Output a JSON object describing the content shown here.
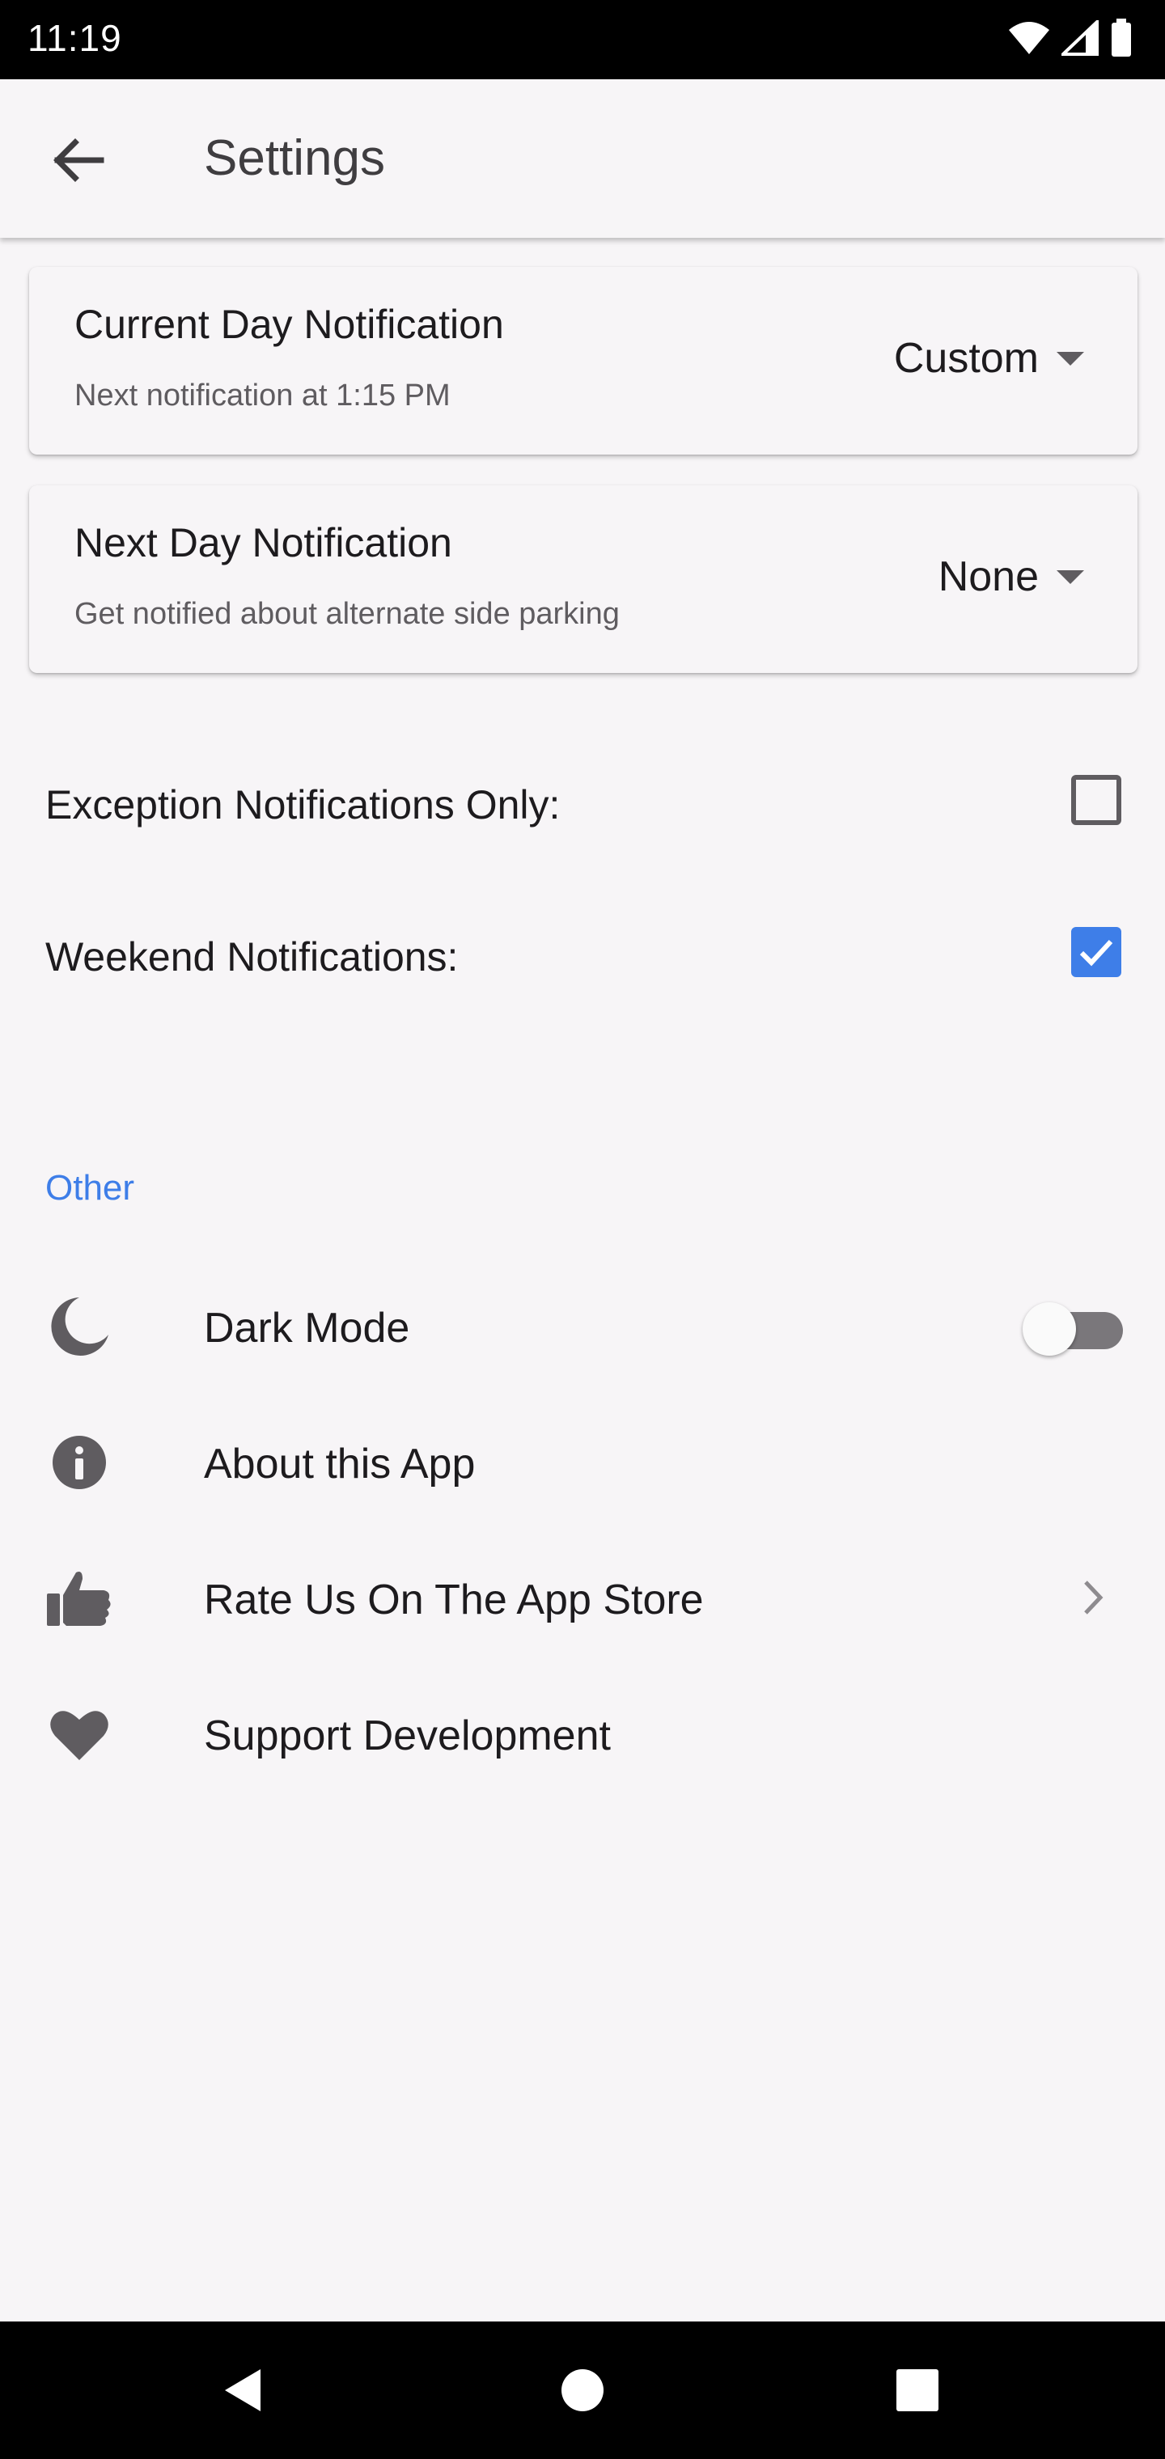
{
  "status_bar": {
    "time": "11:19",
    "icons": [
      "wifi-icon",
      "cellular-signal-icon",
      "battery-icon"
    ]
  },
  "app_bar": {
    "back_icon": "arrow-left-icon",
    "title": "Settings"
  },
  "notification_cards": [
    {
      "title": "Current Day Notification",
      "subtitle": "Next notification at 1:15 PM",
      "selected_value": "Custom"
    },
    {
      "title": "Next Day Notification",
      "subtitle": "Get notified about alternate side parking",
      "selected_value": "None"
    }
  ],
  "checkboxes": [
    {
      "label": "Exception Notifications Only:",
      "checked": false
    },
    {
      "label": "Weekend Notifications:",
      "checked": true
    }
  ],
  "other_section": {
    "header": "Other",
    "items": [
      {
        "label": "Dark Mode",
        "icon": "moon-icon",
        "control": "toggle",
        "toggle_on": false
      },
      {
        "label": "About this App",
        "icon": "info-icon",
        "control": "none"
      },
      {
        "label": "Rate Us On The App Store",
        "icon": "thumbs-up-icon",
        "control": "chevron"
      },
      {
        "label": "Support Development",
        "icon": "heart-icon",
        "control": "none"
      }
    ]
  },
  "nav_bar": {
    "buttons": [
      "back-triangle-icon",
      "home-circle-icon",
      "recents-square-icon"
    ]
  },
  "colors": {
    "background": "#f7f5f7",
    "accent": "#3e7ee8",
    "icon_gray": "#5f5c60"
  }
}
